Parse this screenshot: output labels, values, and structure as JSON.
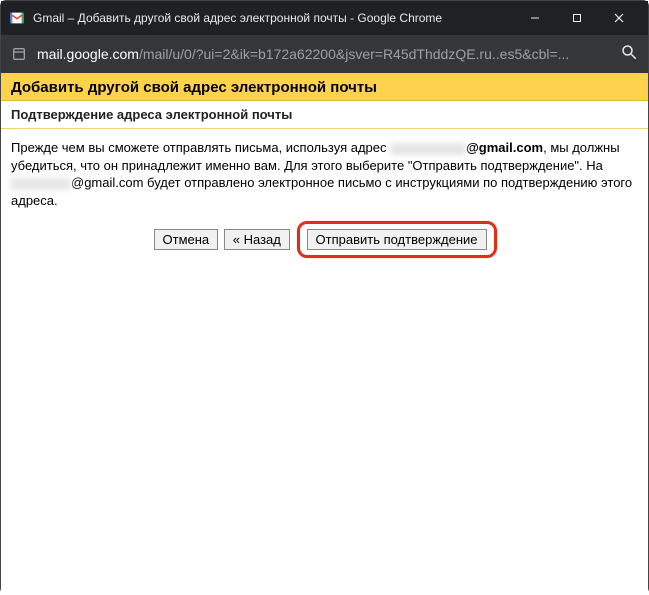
{
  "window": {
    "title": "Gmail – Добавить другой свой адрес электронной почты - Google Chrome"
  },
  "address": {
    "host": "mail.google.com",
    "path": "/mail/u/0/?ui=2&ik=b172a62200&jsver=R45dThddzQE.ru..es5&cbl=..."
  },
  "page": {
    "heading": "Добавить другой свой адрес электронной почты",
    "subheading": "Подтверждение адреса электронной почты",
    "body_prefix": "Прежде чем вы сможете отправлять письма, используя адрес ",
    "body_email_domain": "@gmail.com",
    "body_middle": ", мы должны убедиться, что он принадлежит именно вам. Для этого выберите \"Отправить подтверждение\". На ",
    "body_suffix": "@gmail.com будет отправлено электронное письмо с инструкциями по подтверждению этого адреса."
  },
  "buttons": {
    "cancel": "Отмена",
    "back": "« Назад",
    "send": "Отправить подтверждение"
  }
}
